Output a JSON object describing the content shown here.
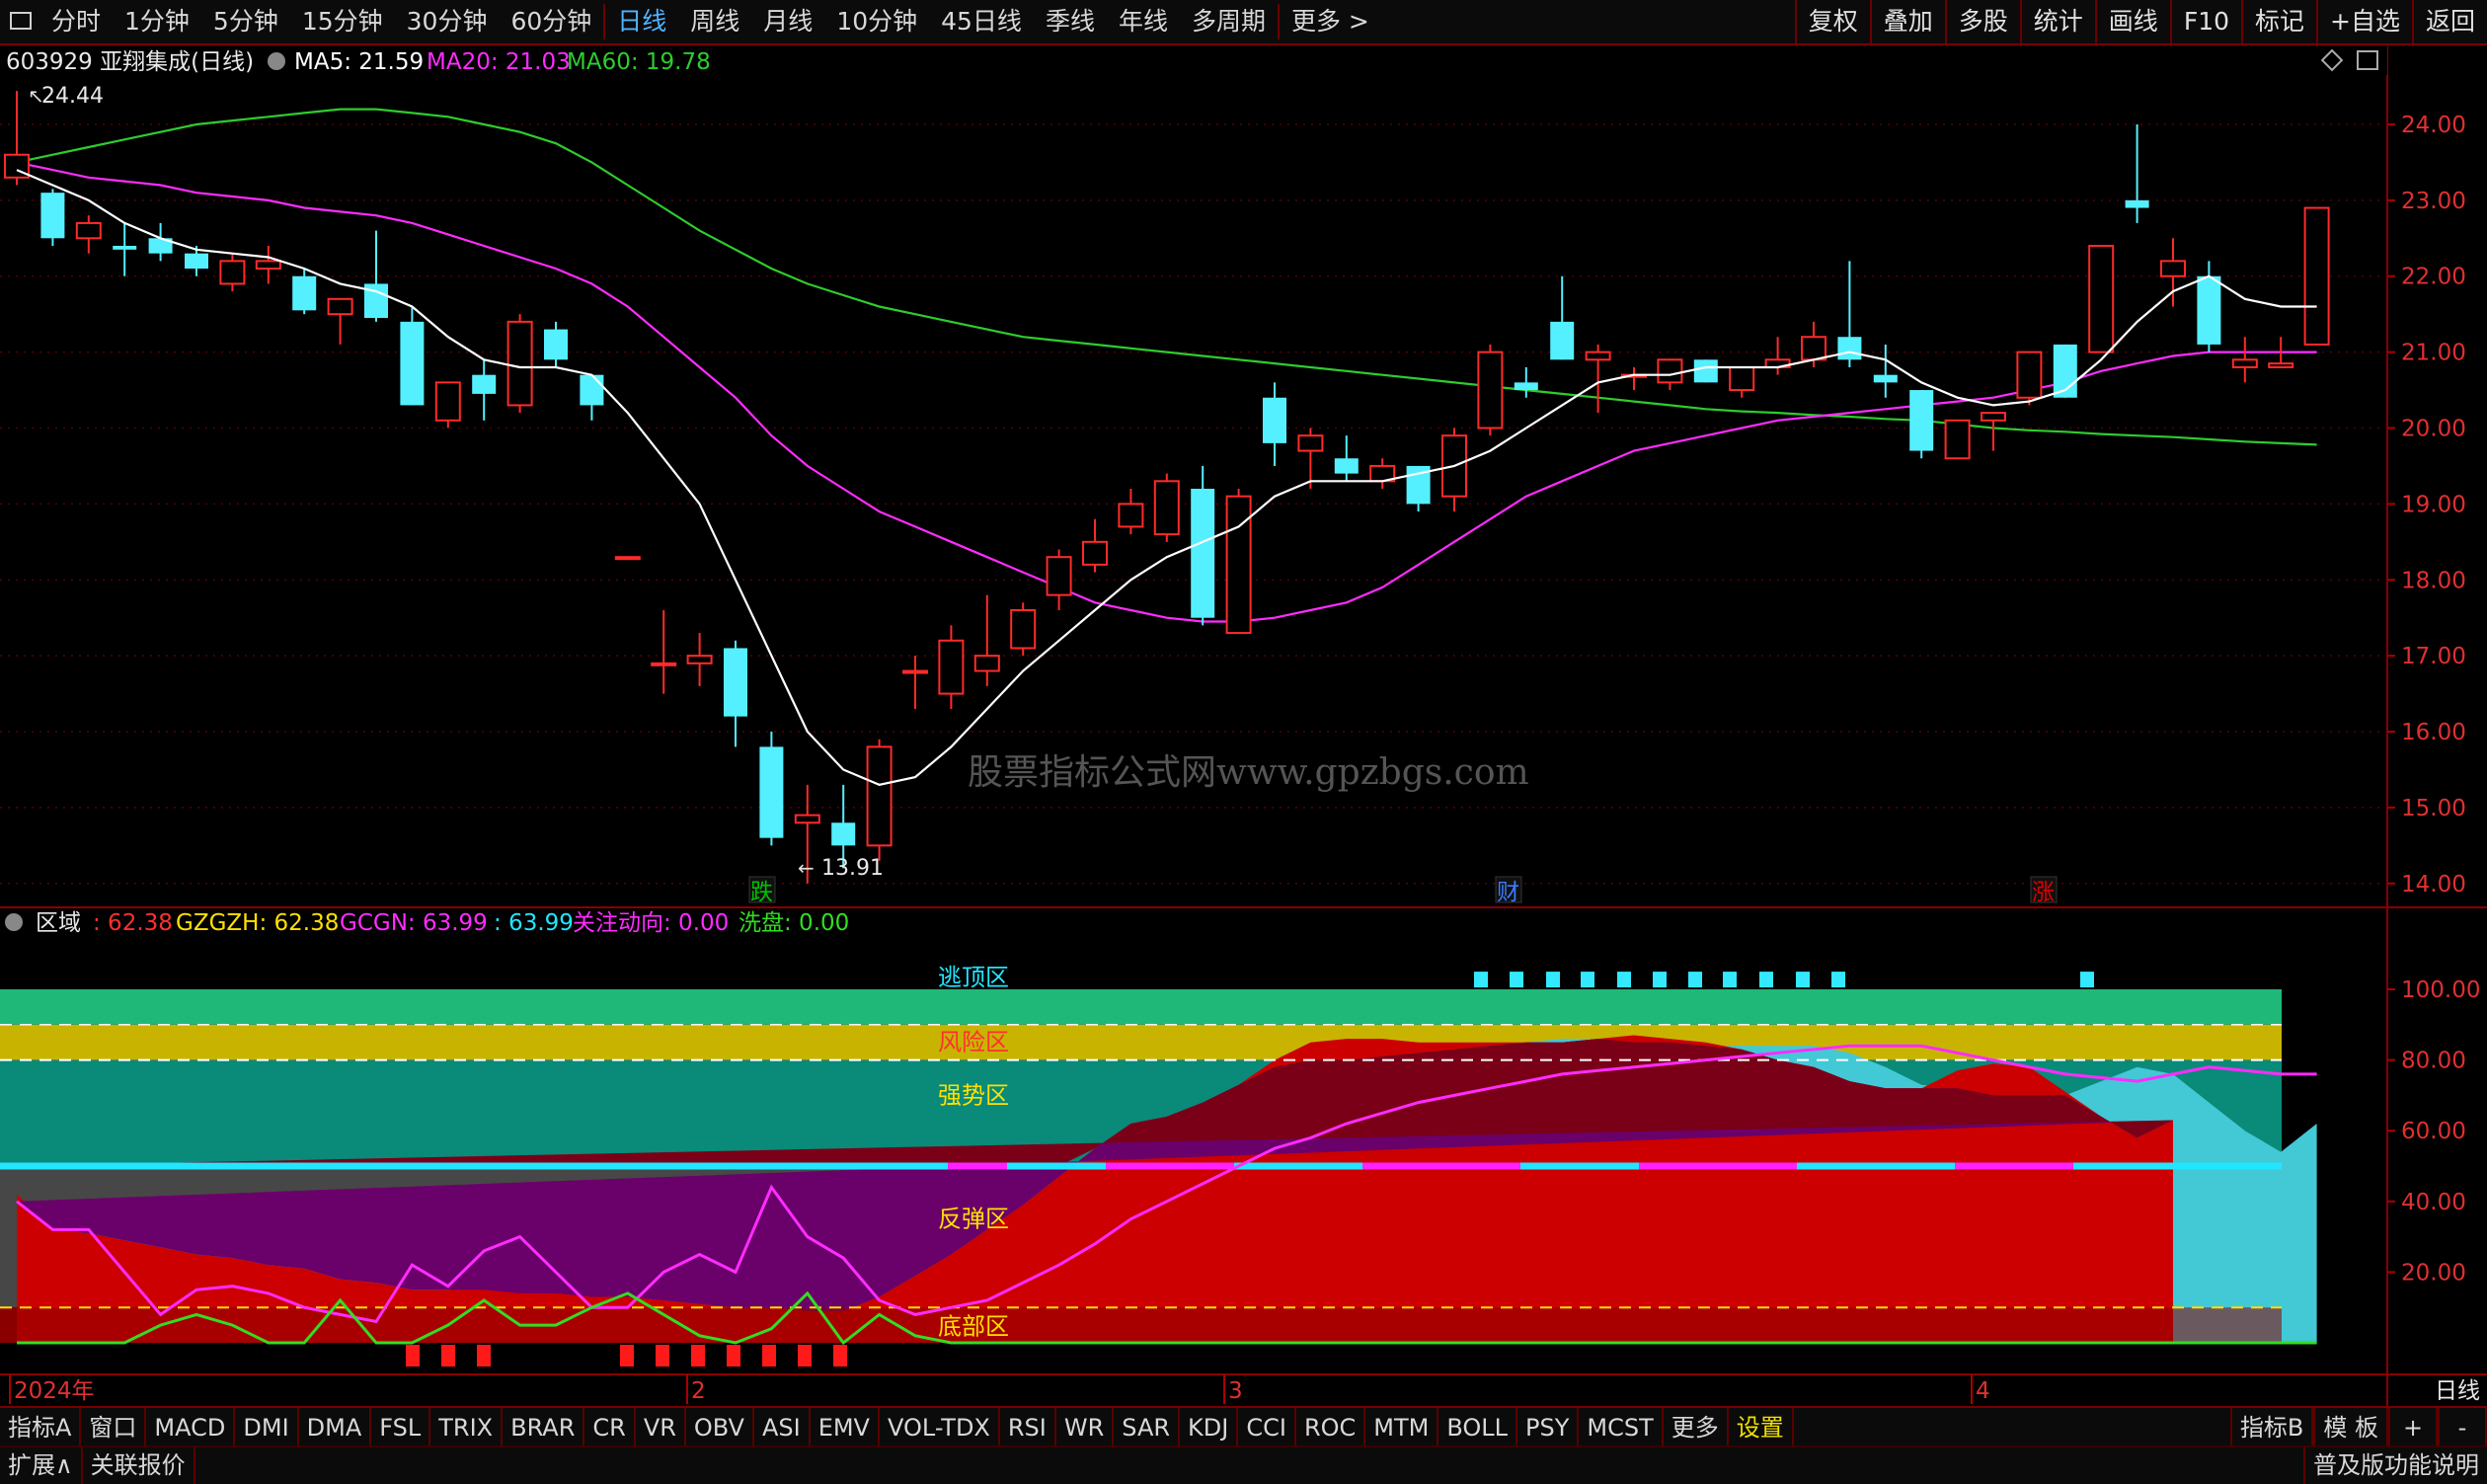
{
  "toolbar": {
    "periods": [
      "分时",
      "1分钟",
      "5分钟",
      "15分钟",
      "30分钟",
      "60分钟",
      "日线",
      "周线",
      "月线",
      "10分钟",
      "45日线",
      "季线",
      "年线",
      "多周期",
      "更多 >"
    ],
    "active": "日线",
    "right": [
      "复权",
      "叠加",
      "多股",
      "统计",
      "画线",
      "F10",
      "标记",
      "+自选",
      "返回"
    ]
  },
  "main": {
    "stock_title": "603929 亚翔集成(日线)",
    "ma5": "MA5: 21.59",
    "ma20": "MA20: 21.03",
    "ma60": "MA60: 19.78",
    "high_label": "24.44",
    "low_label": "13.91",
    "yticks": [
      "24.00",
      "23.00",
      "22.00",
      "21.00",
      "20.00",
      "19.00",
      "18.00",
      "17.00",
      "16.00",
      "15.00",
      "14.00"
    ],
    "watermark": "股票指标公式网www.gpzbgs.com",
    "markers": [
      {
        "text": "跌",
        "color": "#00c000"
      },
      {
        "text": "财",
        "color": "#3a7cff"
      },
      {
        "text": "涨",
        "color": "#e00000"
      }
    ]
  },
  "indicator": {
    "name": "区域",
    "v0": ": 62.38",
    "gzgzh": "GZGZH: 62.38",
    "gcgn": "GCGN: 63.99",
    "v3": ": 63.99",
    "gzdx": "关注动向: 0.00",
    "xp": "洗盘: 0.00",
    "yticks": [
      "100.00",
      "80.00",
      "60.00",
      "40.00",
      "20.00"
    ],
    "zones": [
      "逃顶区",
      "风险区",
      "强势区",
      "反弹区",
      "底部区"
    ]
  },
  "xaxis": {
    "labels": [
      "2024年",
      "2",
      "3",
      "4"
    ],
    "right": "日线"
  },
  "bottom_tabs": [
    "指标A",
    "窗口",
    "MACD",
    "DMI",
    "DMA",
    "FSL",
    "TRIX",
    "BRAR",
    "CR",
    "VR",
    "OBV",
    "ASI",
    "EMV",
    "VOL-TDX",
    "RSI",
    "WR",
    "SAR",
    "KDJ",
    "CCI",
    "ROC",
    "MTM",
    "BOLL",
    "PSY",
    "MCST",
    "更多",
    "设置"
  ],
  "bottom_right": [
    "指标B",
    "模 板",
    "+",
    "-"
  ],
  "status": {
    "left": [
      "扩展∧",
      "关联报价"
    ],
    "right": "普及版功能说明"
  },
  "colors": {
    "up": "#ff2a2a",
    "down": "#54f0ff",
    "ma5": "#ffffff",
    "ma20": "#ff2cff",
    "ma60": "#2ecc2e"
  },
  "chart_data": {
    "type": "candlestick",
    "candles": [
      {
        "o": 23.3,
        "h": 24.44,
        "l": 23.2,
        "c": 23.6
      },
      {
        "o": 23.1,
        "h": 23.15,
        "l": 22.4,
        "c": 22.5
      },
      {
        "o": 22.5,
        "h": 22.8,
        "l": 22.3,
        "c": 22.7
      },
      {
        "o": 22.4,
        "h": 22.7,
        "l": 22.0,
        "c": 22.35
      },
      {
        "o": 22.5,
        "h": 22.7,
        "l": 22.2,
        "c": 22.3
      },
      {
        "o": 22.3,
        "h": 22.4,
        "l": 22.0,
        "c": 22.1
      },
      {
        "o": 21.9,
        "h": 22.3,
        "l": 21.8,
        "c": 22.2
      },
      {
        "o": 22.1,
        "h": 22.4,
        "l": 21.9,
        "c": 22.2
      },
      {
        "o": 22.0,
        "h": 22.1,
        "l": 21.5,
        "c": 21.55
      },
      {
        "o": 21.5,
        "h": 21.7,
        "l": 21.1,
        "c": 21.7
      },
      {
        "o": 21.9,
        "h": 22.6,
        "l": 21.4,
        "c": 21.45
      },
      {
        "o": 21.4,
        "h": 21.6,
        "l": 20.3,
        "c": 20.3
      },
      {
        "o": 20.1,
        "h": 20.6,
        "l": 20.0,
        "c": 20.6
      },
      {
        "o": 20.7,
        "h": 20.9,
        "l": 20.1,
        "c": 20.45
      },
      {
        "o": 20.3,
        "h": 21.5,
        "l": 20.2,
        "c": 21.4
      },
      {
        "o": 21.3,
        "h": 21.4,
        "l": 20.8,
        "c": 20.9
      },
      {
        "o": 20.7,
        "h": 20.7,
        "l": 20.1,
        "c": 20.3
      },
      {
        "o": 18.3,
        "h": 18.3,
        "l": 18.3,
        "c": 18.3
      },
      {
        "o": 16.9,
        "h": 17.6,
        "l": 16.5,
        "c": 16.9
      },
      {
        "o": 16.9,
        "h": 17.3,
        "l": 16.6,
        "c": 17.0
      },
      {
        "o": 17.1,
        "h": 17.2,
        "l": 15.8,
        "c": 16.2
      },
      {
        "o": 15.8,
        "h": 16.0,
        "l": 14.5,
        "c": 14.6
      },
      {
        "o": 14.8,
        "h": 15.3,
        "l": 14.0,
        "c": 14.9
      },
      {
        "o": 14.8,
        "h": 15.3,
        "l": 14.2,
        "c": 14.5
      },
      {
        "o": 14.5,
        "h": 15.9,
        "l": 14.3,
        "c": 15.8
      },
      {
        "o": 16.8,
        "h": 17.0,
        "l": 16.3,
        "c": 16.8
      },
      {
        "o": 16.5,
        "h": 17.4,
        "l": 16.3,
        "c": 17.2
      },
      {
        "o": 16.8,
        "h": 17.8,
        "l": 16.6,
        "c": 17.0
      },
      {
        "o": 17.1,
        "h": 17.7,
        "l": 17.0,
        "c": 17.6
      },
      {
        "o": 17.8,
        "h": 18.4,
        "l": 17.6,
        "c": 18.3
      },
      {
        "o": 18.2,
        "h": 18.8,
        "l": 18.1,
        "c": 18.5
      },
      {
        "o": 18.7,
        "h": 19.2,
        "l": 18.6,
        "c": 19.0
      },
      {
        "o": 18.6,
        "h": 19.4,
        "l": 18.5,
        "c": 19.3
      },
      {
        "o": 19.2,
        "h": 19.5,
        "l": 17.4,
        "c": 17.5
      },
      {
        "o": 17.3,
        "h": 19.2,
        "l": 17.3,
        "c": 19.1
      },
      {
        "o": 20.4,
        "h": 20.6,
        "l": 19.5,
        "c": 19.8
      },
      {
        "o": 19.7,
        "h": 20.0,
        "l": 19.2,
        "c": 19.9
      },
      {
        "o": 19.6,
        "h": 19.9,
        "l": 19.3,
        "c": 19.4
      },
      {
        "o": 19.3,
        "h": 19.6,
        "l": 19.2,
        "c": 19.5
      },
      {
        "o": 19.5,
        "h": 19.5,
        "l": 18.9,
        "c": 19.0
      },
      {
        "o": 19.1,
        "h": 20.0,
        "l": 18.9,
        "c": 19.9
      },
      {
        "o": 20.0,
        "h": 21.1,
        "l": 19.9,
        "c": 21.0
      },
      {
        "o": 20.6,
        "h": 20.8,
        "l": 20.4,
        "c": 20.5
      },
      {
        "o": 21.4,
        "h": 22.0,
        "l": 20.9,
        "c": 20.9
      },
      {
        "o": 20.9,
        "h": 21.1,
        "l": 20.2,
        "c": 21.0
      },
      {
        "o": 20.7,
        "h": 20.8,
        "l": 20.5,
        "c": 20.7
      },
      {
        "o": 20.6,
        "h": 20.9,
        "l": 20.5,
        "c": 20.9
      },
      {
        "o": 20.9,
        "h": 20.9,
        "l": 20.6,
        "c": 20.6
      },
      {
        "o": 20.5,
        "h": 20.8,
        "l": 20.4,
        "c": 20.8
      },
      {
        "o": 20.8,
        "h": 21.2,
        "l": 20.7,
        "c": 20.9
      },
      {
        "o": 20.9,
        "h": 21.4,
        "l": 20.8,
        "c": 21.2
      },
      {
        "o": 21.2,
        "h": 22.2,
        "l": 20.8,
        "c": 20.9
      },
      {
        "o": 20.7,
        "h": 21.1,
        "l": 20.4,
        "c": 20.6
      },
      {
        "o": 20.5,
        "h": 20.5,
        "l": 19.6,
        "c": 19.7
      },
      {
        "o": 19.6,
        "h": 20.1,
        "l": 19.6,
        "c": 20.1
      },
      {
        "o": 20.1,
        "h": 20.2,
        "l": 19.7,
        "c": 20.2
      },
      {
        "o": 20.4,
        "h": 21.0,
        "l": 20.3,
        "c": 21.0
      },
      {
        "o": 21.1,
        "h": 21.1,
        "l": 20.4,
        "c": 20.4
      },
      {
        "o": 21.0,
        "h": 22.4,
        "l": 21.0,
        "c": 22.4
      },
      {
        "o": 23.0,
        "h": 24.0,
        "l": 22.7,
        "c": 22.9
      },
      {
        "o": 22.0,
        "h": 22.5,
        "l": 21.6,
        "c": 22.2
      },
      {
        "o": 22.0,
        "h": 22.2,
        "l": 21.0,
        "c": 21.1
      },
      {
        "o": 20.8,
        "h": 21.2,
        "l": 20.6,
        "c": 20.9
      },
      {
        "o": 20.8,
        "h": 21.2,
        "l": 20.8,
        "c": 20.85
      },
      {
        "o": 21.1,
        "h": 22.9,
        "l": 21.1,
        "c": 22.9
      }
    ],
    "ma5": [
      23.4,
      23.2,
      23.0,
      22.7,
      22.5,
      22.35,
      22.3,
      22.25,
      22.1,
      21.9,
      21.8,
      21.6,
      21.2,
      20.9,
      20.8,
      20.8,
      20.7,
      20.2,
      19.6,
      19.0,
      18.0,
      17.0,
      16.0,
      15.5,
      15.3,
      15.4,
      15.8,
      16.3,
      16.8,
      17.2,
      17.6,
      18.0,
      18.3,
      18.5,
      18.7,
      19.1,
      19.3,
      19.3,
      19.3,
      19.4,
      19.5,
      19.7,
      20.0,
      20.3,
      20.6,
      20.7,
      20.7,
      20.8,
      20.8,
      20.8,
      20.9,
      21.0,
      20.9,
      20.6,
      20.4,
      20.3,
      20.35,
      20.5,
      20.9,
      21.4,
      21.8,
      22.0,
      21.7,
      21.6,
      21.6
    ],
    "ma20": [
      23.5,
      23.4,
      23.3,
      23.25,
      23.2,
      23.1,
      23.05,
      23.0,
      22.9,
      22.85,
      22.8,
      22.7,
      22.55,
      22.4,
      22.25,
      22.1,
      21.9,
      21.6,
      21.2,
      20.8,
      20.4,
      19.9,
      19.5,
      19.2,
      18.9,
      18.7,
      18.5,
      18.3,
      18.1,
      17.9,
      17.7,
      17.6,
      17.5,
      17.45,
      17.45,
      17.5,
      17.6,
      17.7,
      17.9,
      18.2,
      18.5,
      18.8,
      19.1,
      19.3,
      19.5,
      19.7,
      19.8,
      19.9,
      20.0,
      20.1,
      20.15,
      20.2,
      20.25,
      20.3,
      20.35,
      20.4,
      20.5,
      20.6,
      20.75,
      20.85,
      20.95,
      21.0,
      21.0,
      21.0,
      21.0
    ],
    "ma60": [
      23.5,
      23.6,
      23.7,
      23.8,
      23.9,
      24.0,
      24.05,
      24.1,
      24.15,
      24.2,
      24.2,
      24.15,
      24.1,
      24.0,
      23.9,
      23.75,
      23.5,
      23.2,
      22.9,
      22.6,
      22.35,
      22.1,
      21.9,
      21.75,
      21.6,
      21.5,
      21.4,
      21.3,
      21.2,
      21.15,
      21.1,
      21.05,
      21.0,
      20.95,
      20.9,
      20.85,
      20.8,
      20.75,
      20.7,
      20.65,
      20.6,
      20.55,
      20.5,
      20.45,
      20.4,
      20.35,
      20.3,
      20.25,
      20.22,
      20.2,
      20.17,
      20.15,
      20.12,
      20.1,
      20.05,
      20.0,
      19.97,
      19.95,
      19.92,
      19.9,
      19.88,
      19.85,
      19.82,
      19.8,
      19.78
    ],
    "ind_main": [
      40,
      33,
      32,
      30,
      28,
      26,
      25,
      23,
      22,
      20,
      19,
      17,
      16,
      15,
      14,
      14,
      13,
      13,
      12,
      11,
      10,
      10,
      9,
      9,
      13,
      19,
      25,
      32,
      39,
      47,
      55,
      62,
      64,
      68,
      73,
      78,
      80,
      80,
      81,
      82,
      83,
      84,
      85,
      86,
      86,
      85,
      85,
      84,
      84,
      84,
      84,
      82,
      78,
      73,
      72,
      70,
      70,
      70,
      74,
      78,
      76,
      68,
      60,
      54,
      62
    ],
    "ind_red": [
      42,
      32,
      31,
      29,
      27,
      25,
      24,
      22,
      21,
      18,
      17,
      15,
      15,
      16,
      17,
      17,
      15,
      13,
      12,
      11,
      10,
      10,
      9,
      9,
      13,
      19,
      25,
      32,
      39,
      47,
      55,
      62,
      64,
      68,
      73,
      80,
      85,
      86,
      86,
      85,
      85,
      85,
      85,
      85,
      86,
      87,
      86,
      85,
      83,
      80,
      78,
      74,
      72,
      72,
      77,
      79,
      78,
      71,
      64,
      58,
      63
    ],
    "ind_magenta": [
      33,
      33,
      28,
      25,
      24,
      22,
      20,
      19,
      17,
      16,
      15,
      13,
      12,
      12,
      11,
      10,
      10,
      9,
      9,
      9,
      10,
      12,
      14,
      17,
      21,
      26,
      31,
      37,
      42,
      47,
      51,
      55,
      57,
      61,
      66,
      71,
      75,
      77,
      79,
      80,
      81,
      82,
      83,
      84,
      84,
      84,
      84,
      83,
      82,
      78,
      76,
      76,
      77,
      78
    ],
    "ind_green": [
      1,
      1,
      1,
      1,
      1,
      1,
      1,
      1,
      1,
      1,
      1,
      1,
      1,
      1,
      1,
      1,
      1,
      1,
      1,
      1,
      1,
      1,
      1,
      1,
      1,
      1,
      1,
      1,
      1,
      1,
      1,
      1,
      1,
      1,
      1,
      1,
      1,
      1,
      1,
      1,
      1,
      1,
      1,
      1,
      1,
      1,
      1,
      1,
      1,
      1,
      1,
      1,
      1,
      1,
      1,
      1,
      1,
      1,
      1,
      1,
      1,
      1,
      1,
      1,
      1
    ]
  }
}
